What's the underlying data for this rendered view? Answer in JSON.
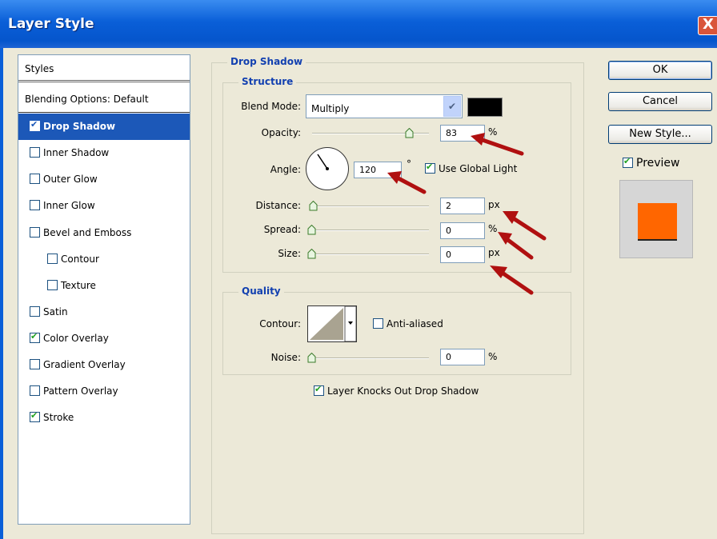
{
  "window": {
    "title": "Layer Style",
    "close_label": "X"
  },
  "styles": {
    "header": "Styles",
    "blending_options": "Blending Options: Default",
    "items": [
      {
        "label": "Drop Shadow",
        "checked": true
      },
      {
        "label": "Inner Shadow",
        "checked": false
      },
      {
        "label": "Outer Glow",
        "checked": false
      },
      {
        "label": "Inner Glow",
        "checked": false
      },
      {
        "label": "Bevel and Emboss",
        "checked": false
      },
      {
        "label": "Contour",
        "checked": false
      },
      {
        "label": "Texture",
        "checked": false
      },
      {
        "label": "Satin",
        "checked": false
      },
      {
        "label": "Color Overlay",
        "checked": true
      },
      {
        "label": "Gradient Overlay",
        "checked": false
      },
      {
        "label": "Pattern Overlay",
        "checked": false
      },
      {
        "label": "Stroke",
        "checked": true
      }
    ]
  },
  "drop_shadow": {
    "title": "Drop Shadow",
    "structure": {
      "title": "Structure",
      "blend_mode_label": "Blend Mode:",
      "blend_mode_value": "Multiply",
      "shadow_color": "#000000",
      "opacity_label": "Opacity:",
      "opacity_value": "83",
      "opacity_unit": "%",
      "angle_label": "Angle:",
      "angle_value": "120",
      "angle_unit": "°",
      "use_global_light_label": "Use Global Light",
      "use_global_light": true,
      "distance_label": "Distance:",
      "distance_value": "2",
      "distance_unit": "px",
      "spread_label": "Spread:",
      "spread_value": "0",
      "spread_unit": "%",
      "size_label": "Size:",
      "size_value": "0",
      "size_unit": "px"
    },
    "quality": {
      "title": "Quality",
      "contour_label": "Contour:",
      "anti_aliased_label": "Anti-aliased",
      "anti_aliased": false,
      "noise_label": "Noise:",
      "noise_value": "0",
      "noise_unit": "%"
    },
    "knocks_out_label": "Layer Knocks Out Drop Shadow",
    "knocks_out": true
  },
  "buttons": {
    "ok": "OK",
    "cancel": "Cancel",
    "new_style": "New Style...",
    "preview_label": "Preview",
    "preview": true
  },
  "colors": {
    "preview_swatch": "#ff6600",
    "accent": "#1c58b8",
    "annotation_arrow": "#b01010"
  }
}
